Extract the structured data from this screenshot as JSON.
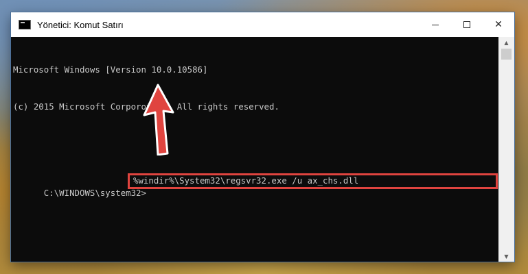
{
  "window": {
    "title": "Yönetici: Komut Satırı",
    "minimize_glyph": "",
    "maximize_glyph": "",
    "close_glyph": "✕"
  },
  "console": {
    "line1": "Microsoft Windows [Version 10.0.10586]",
    "line2": "(c) 2015 Microsoft Corporotion. All rights reserved.",
    "prompt": "C:\\WINDOWS\\system32>",
    "command": "%windir%\\System32\\regsvr32.exe /u ax_chs.dll"
  },
  "colors": {
    "highlight_box": "#e0443f",
    "arrow": "#e0443f",
    "console_bg": "#0c0c0c",
    "console_text": "#c8c8c8"
  },
  "icons": {
    "title_icon": "cmd-window-icon",
    "annotation": "red-arrow-icon"
  }
}
